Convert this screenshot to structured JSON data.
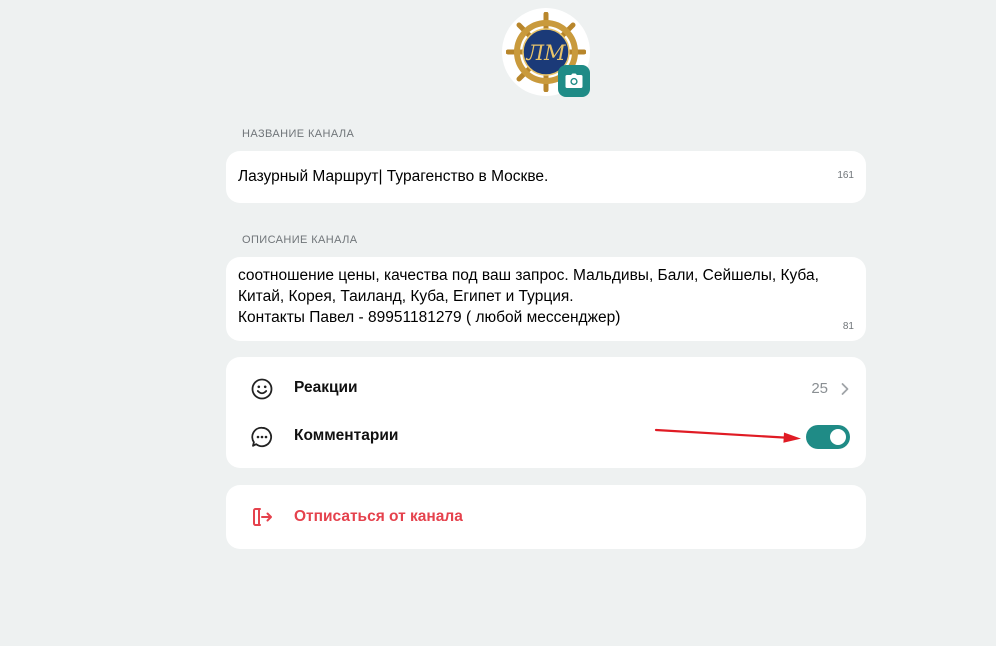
{
  "avatar": {
    "monogram": "ЛМ",
    "icon": "ship-wheel-logo"
  },
  "avatar_camera": {
    "icon": "camera-icon"
  },
  "name_section": {
    "label": "НАЗВАНИЕ КАНАЛА",
    "value": "Лазурный Маршрут| Турагенство в Москве.",
    "counter": "161"
  },
  "description_section": {
    "label": "ОПИСАНИЕ КАНАЛА",
    "value": "соотношение цены, качества под ваш запрос. Мальдивы, Бали, Сейшелы, Куба,\nКитай, Корея, Таиланд, Куба, Египет и Турция.\nКонтакты Павел -  89951181279 ( любой мессенджер)",
    "counter": "81"
  },
  "settings": {
    "reactions": {
      "label": "Реакции",
      "value": "25",
      "icon": "smile-icon"
    },
    "comments": {
      "label": "Комментарии",
      "enabled": true,
      "icon": "chat-bubble-icon"
    }
  },
  "leave": {
    "label": "Отписаться от канала",
    "icon": "logout-icon"
  },
  "colors": {
    "accent": "#1f8b86",
    "danger": "#e5424d",
    "background": "#eef1f1",
    "annotation": "#e01b24"
  }
}
